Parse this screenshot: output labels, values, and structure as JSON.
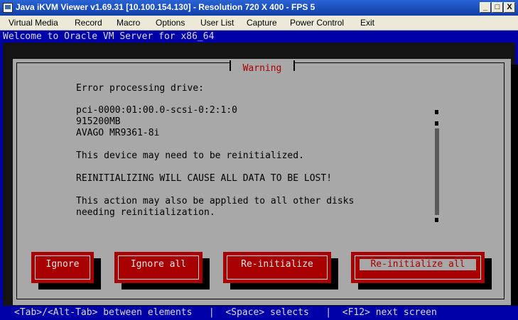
{
  "window": {
    "title": "Java iKVM Viewer v1.69.31 [10.100.154.130] - Resolution 720 X 400 - FPS 5",
    "minimize_glyph": "_",
    "maximize_glyph": "□",
    "close_glyph": "X"
  },
  "menu": [
    "Virtual Media",
    "Record",
    "Macro",
    "Options",
    "User List",
    "Capture",
    "Power Control",
    "Exit"
  ],
  "console": {
    "header": "Welcome to Oracle VM Server for x86_64",
    "dialog": {
      "title": "Warning",
      "lines": [
        "Error processing drive:",
        "pci-0000:01:00.0-scsi-0:2:1:0",
        "915200MB",
        "AVAGO MR9361-8i",
        "This device may need to be reinitialized.",
        "REINITIALIZING WILL CAUSE ALL DATA TO BE LOST!",
        "This action may also be applied to all other disks",
        "needing reinitialization."
      ],
      "buttons": {
        "ignore": "Ignore",
        "ignore_all": "Ignore all",
        "reinit": "Re-initialize",
        "reinit_all": "Re-initialize all"
      },
      "focused_button": "Re-initialize all"
    },
    "status": "<Tab>/<Alt-Tab> between elements   |  <Space> selects   |  <F12> next screen"
  },
  "colors": {
    "console_blue": "#0000a8",
    "dialog_gray": "#a8a8a8",
    "button_red": "#a80000",
    "titlebar_blue": "#0f3fa8"
  }
}
